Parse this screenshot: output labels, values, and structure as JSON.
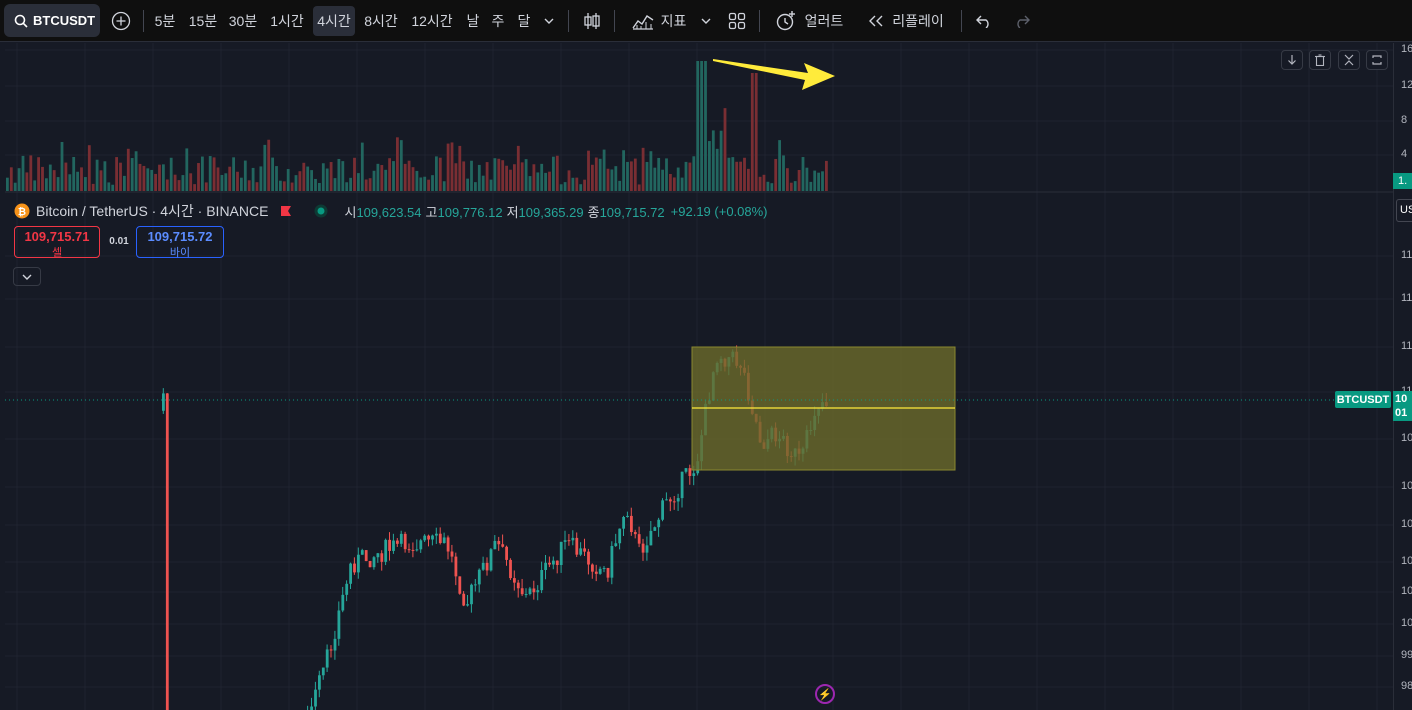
{
  "toolbar": {
    "symbol": "BTCUSDT",
    "intervals": [
      "5분",
      "15분",
      "30분",
      "1시간",
      "4시간",
      "8시간",
      "12시간",
      "날",
      "주",
      "달"
    ],
    "active_interval": "4시간",
    "indicators_label": "지표",
    "alert_label": "얼러트",
    "replay_label": "리플레이"
  },
  "legend": {
    "title": "Bitcoin / TetherUS · 4시간 · BINANCE",
    "open_label": "시",
    "open": "109,623.54",
    "high_label": "고",
    "high": "109,776.12",
    "low_label": "저",
    "low": "109,365.29",
    "close_label": "종",
    "close": "109,715.72",
    "change": "+92.19 (+0.08%)"
  },
  "trade": {
    "sell_price": "109,715.71",
    "sell_label": "셀",
    "spread": "0.01",
    "buy_price": "109,715.72",
    "buy_label": "바이"
  },
  "volume_axis_ticks": [
    "16",
    "12",
    "8",
    "4"
  ],
  "price_axis_ticks": [
    "11",
    "11",
    "11",
    "11",
    "10",
    "10",
    "10",
    "10",
    "10",
    "10",
    "99",
    "98"
  ],
  "axis_labels": {
    "symbol_tag": "BTCUSDT",
    "last_price_line1": "10",
    "last_price_line2": "01",
    "volume_last": "1.",
    "currency": "US"
  },
  "colors": {
    "up": "#26a69a",
    "down": "#ef5350",
    "volume_up": "#22665f",
    "volume_down": "#7a2e33",
    "box_fill": "#6b6a2a",
    "highlight": "#ffeb3b",
    "annotation_arrow": "#ffeb3b"
  },
  "icons": [
    "search-icon",
    "plus-circle-icon",
    "chevron-down-icon",
    "candles-icon",
    "indicators-icon",
    "layout-grid-icon",
    "alert-clock-icon",
    "replay-icon",
    "undo-icon",
    "redo-icon",
    "bitcoin-icon",
    "flag-icon",
    "live-dot-icon",
    "download-icon",
    "trash-icon",
    "collapse-icon",
    "maximize-icon",
    "lightning-icon"
  ],
  "chart_data": {
    "type": "candlestick",
    "note_series": "4-hour candles, price axis labels truncated in screenshot",
    "ohlc_last": {
      "open": 109623.54,
      "high": 109776.12,
      "low": 109365.29,
      "close": 109715.72
    },
    "change": 92.19,
    "change_pct": 0.08,
    "sell": 109715.71,
    "buy": 109715.72,
    "spread": 0.01
  }
}
